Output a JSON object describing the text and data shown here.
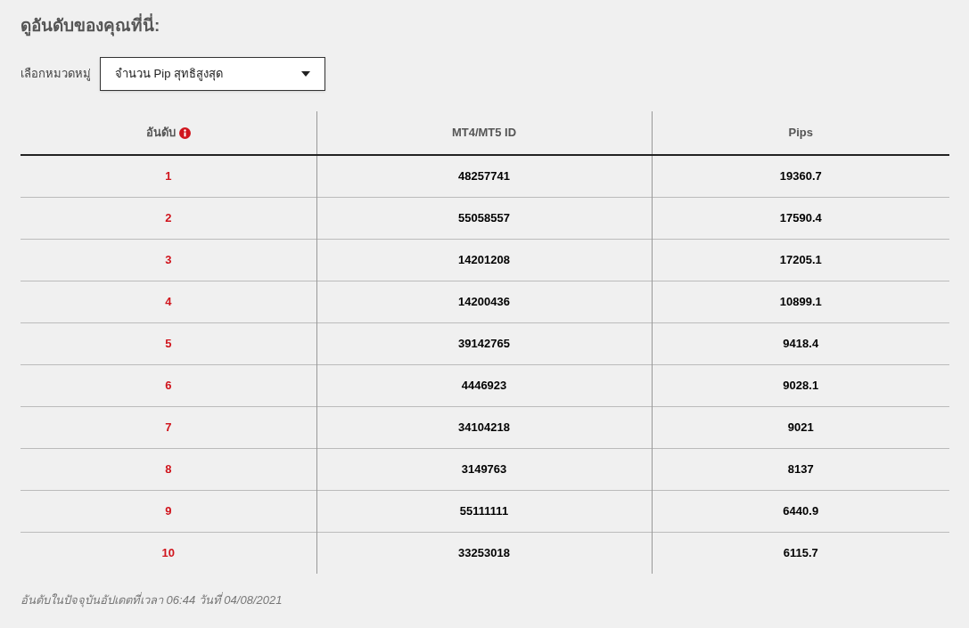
{
  "heading": "ดูอันดับของคุณที่นี่:",
  "category": {
    "label": "เลือกหมวดหมู่",
    "value": "จำนวน Pip สุทธิสูงสุด"
  },
  "table": {
    "columns": [
      "อันดับ",
      "MT4/MT5 ID",
      "Pips"
    ],
    "rows": [
      {
        "rank": "1",
        "id": "48257741",
        "pips": "19360.7"
      },
      {
        "rank": "2",
        "id": "55058557",
        "pips": "17590.4"
      },
      {
        "rank": "3",
        "id": "14201208",
        "pips": "17205.1"
      },
      {
        "rank": "4",
        "id": "14200436",
        "pips": "10899.1"
      },
      {
        "rank": "5",
        "id": "39142765",
        "pips": "9418.4"
      },
      {
        "rank": "6",
        "id": "4446923",
        "pips": "9028.1"
      },
      {
        "rank": "7",
        "id": "34104218",
        "pips": "9021"
      },
      {
        "rank": "8",
        "id": "3149763",
        "pips": "8137"
      },
      {
        "rank": "9",
        "id": "55111111",
        "pips": "6440.9"
      },
      {
        "rank": "10",
        "id": "33253018",
        "pips": "6115.7"
      }
    ]
  },
  "footnote": "อันดับในปัจจุบันอัปเดตที่เวลา 06:44 วันที่ 04/08/2021"
}
